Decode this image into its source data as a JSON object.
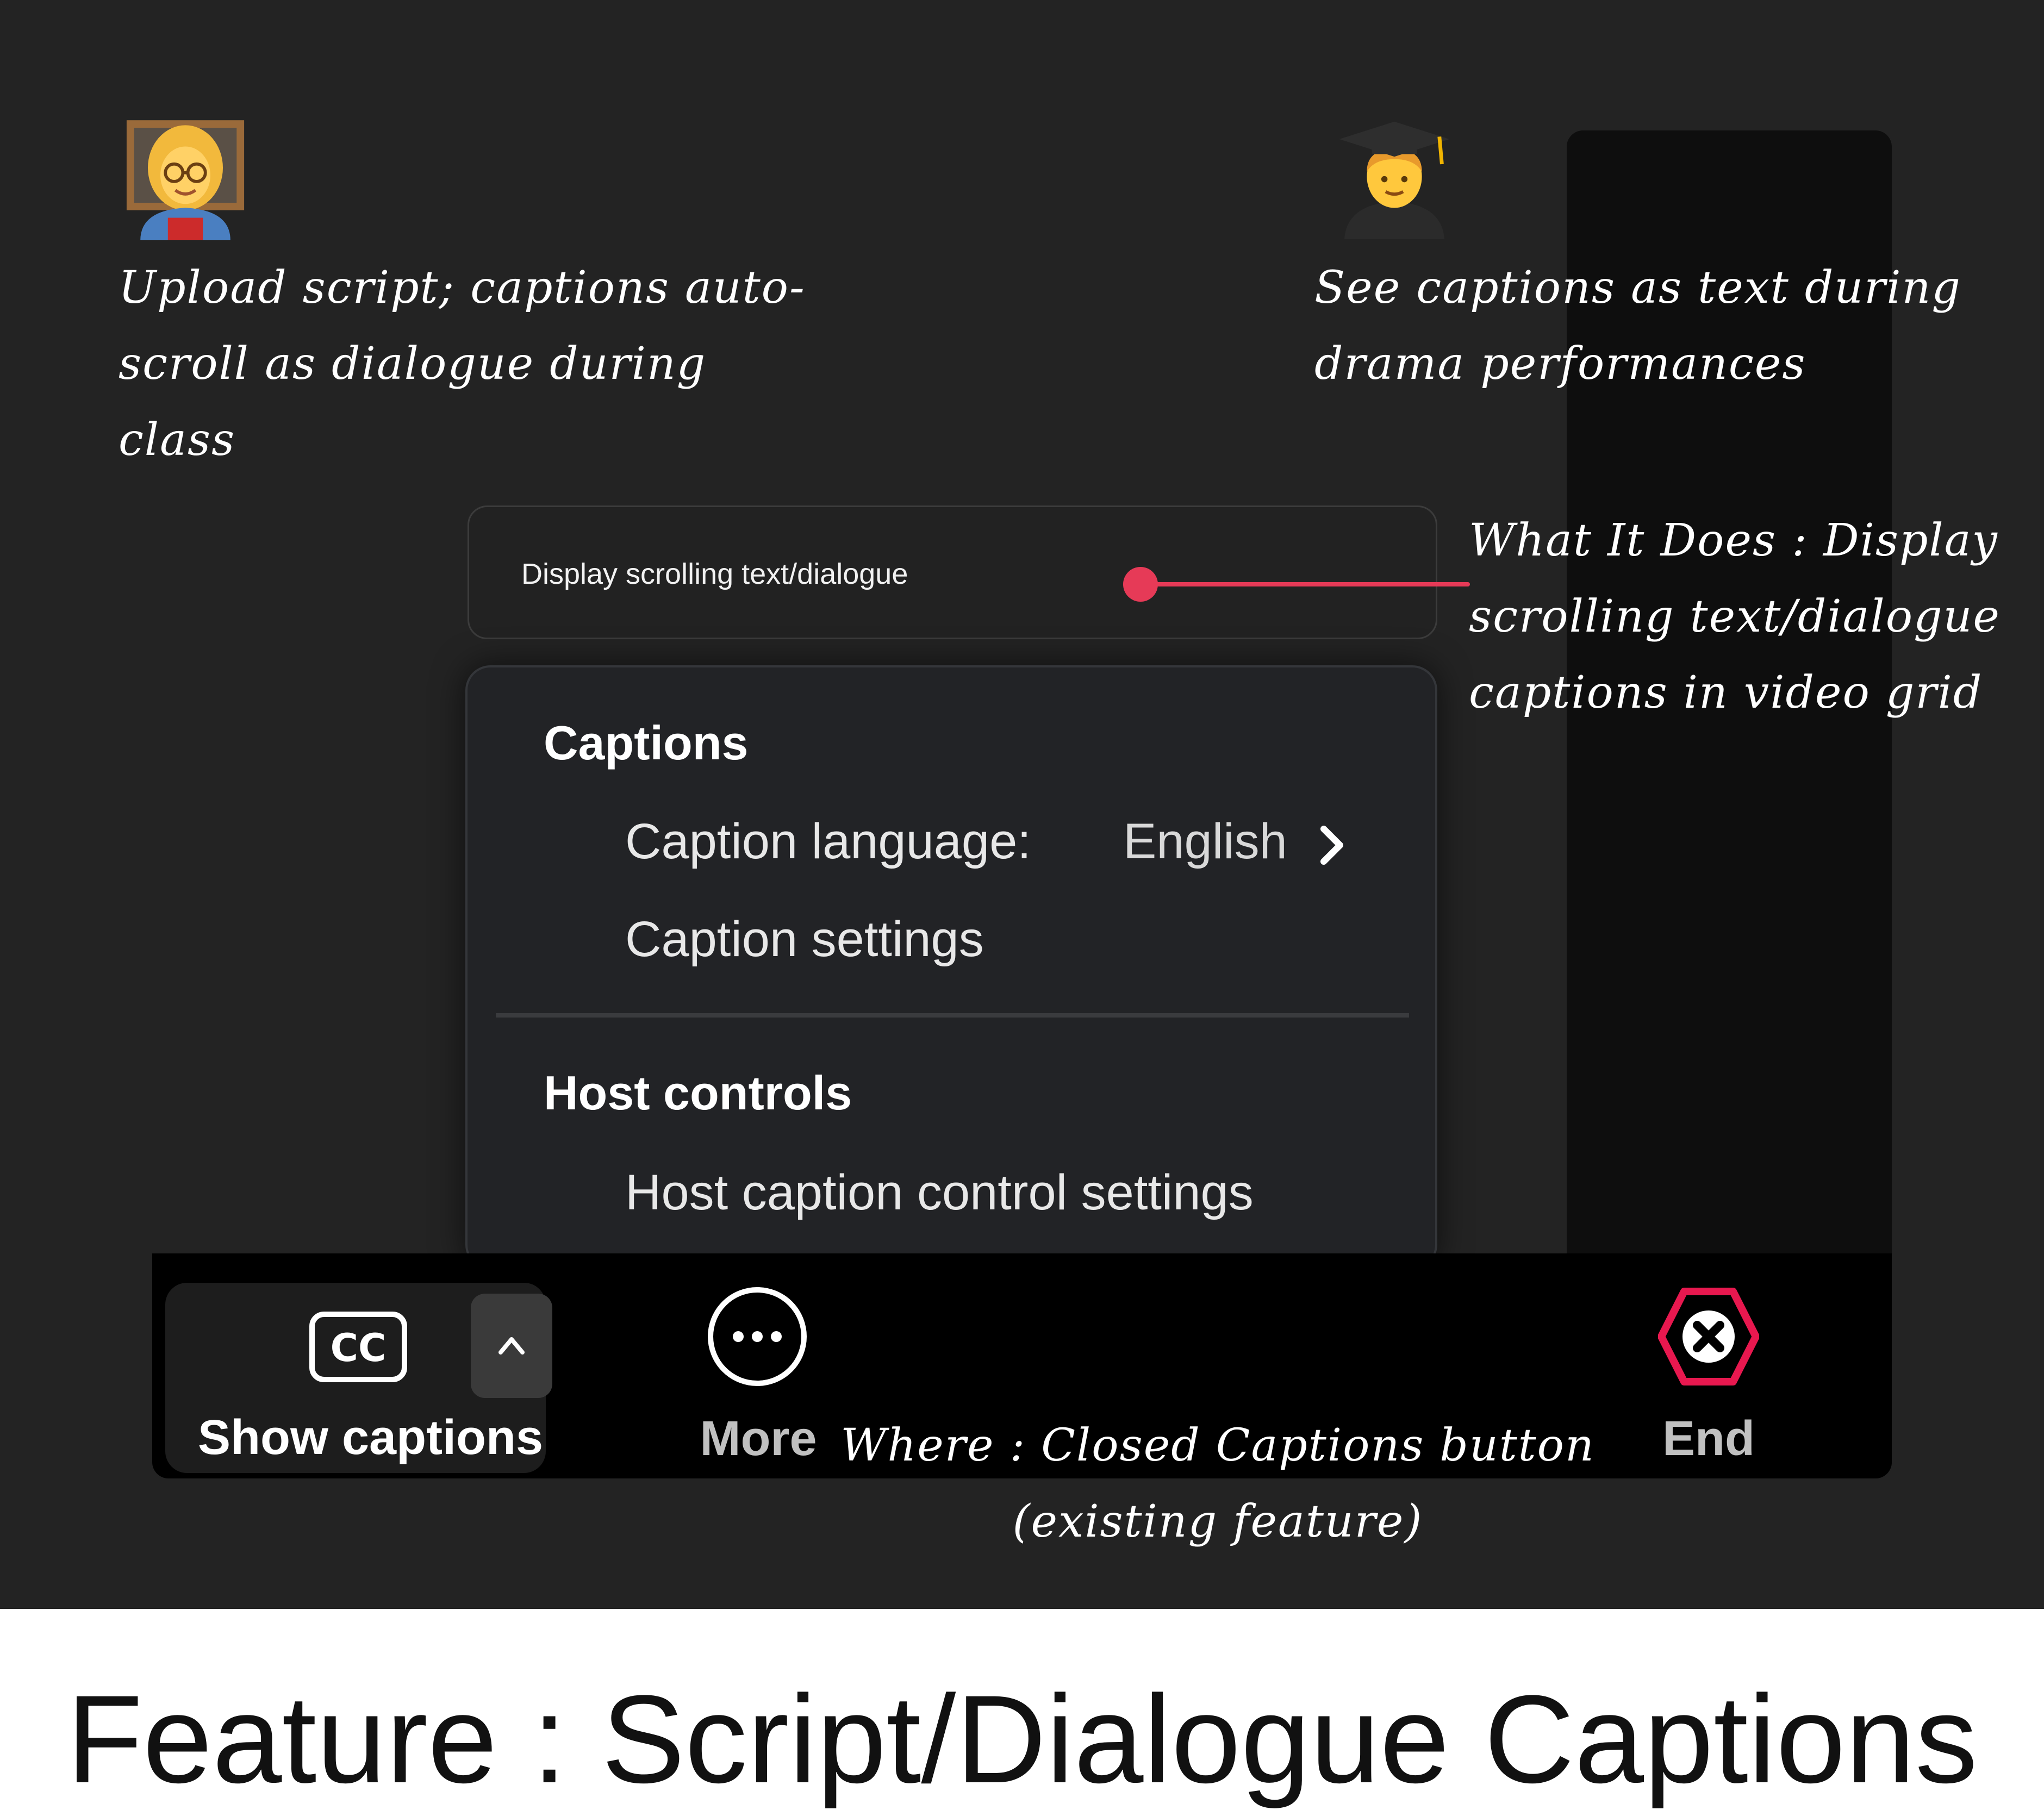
{
  "annotations": {
    "teacher_use_case": "Upload script; captions auto-\nscroll as dialogue during class",
    "student_use_case": "See captions as text during\ndrama performances",
    "what_it_does": "What It Does : Display\nscrolling text/dialogue\ncaptions in video grid",
    "where": "Where : Closed Captions button\n(existing feature)"
  },
  "feature_box": {
    "label": "Display scrolling text/dialogue"
  },
  "captions_menu": {
    "captions_heading": "Captions",
    "caption_language_label": "Caption language:",
    "caption_language_value": "English",
    "caption_settings": "Caption settings",
    "host_controls_heading": "Host controls",
    "host_caption_control_settings": "Host caption control settings"
  },
  "toolbar": {
    "cc_icon_text": "CC",
    "show_captions_label": "Show captions",
    "more_label": "More",
    "end_label": "End"
  },
  "footer": {
    "title": "Feature : Script/Dialogue Captions"
  },
  "colors": {
    "background": "#232323",
    "pointer": "#e63a57",
    "end_button": "#e8184f"
  },
  "icons": [
    "teacher-emoji-icon",
    "student-emoji-icon",
    "closed-captions-icon",
    "chevron-up-icon",
    "chevron-right-icon",
    "more-dots-icon",
    "end-call-icon"
  ]
}
